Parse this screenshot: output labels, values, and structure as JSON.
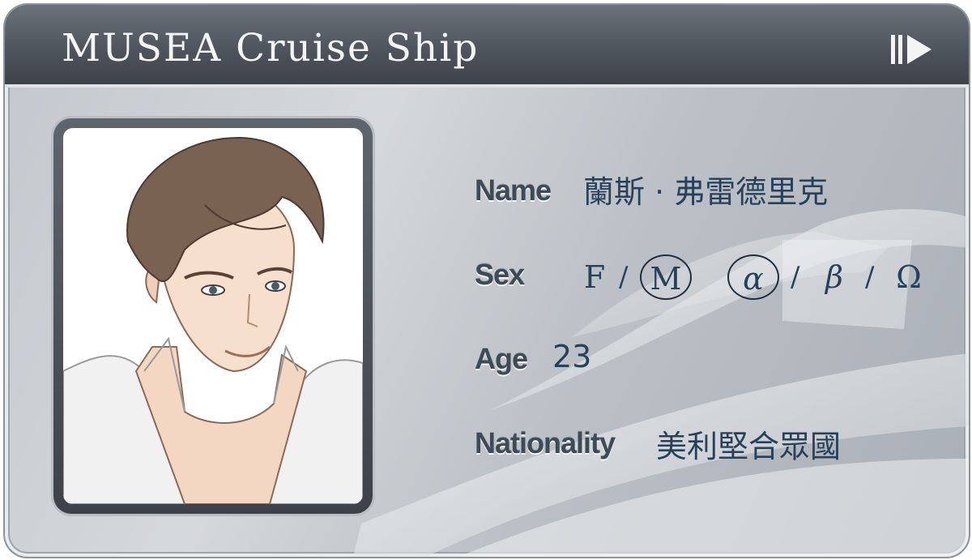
{
  "header": {
    "title": "MUSEA Cruise Ship",
    "skip_icon": "skip-forward-icon"
  },
  "profile": {
    "portrait": "character-portrait",
    "name": {
      "label": "Name",
      "value": "蘭斯 · 弗雷德里克"
    },
    "sex": {
      "label": "Sex",
      "gender_options": [
        "F",
        "M"
      ],
      "gender_selected": "M",
      "secondary_options": [
        "α",
        "β",
        "Ω"
      ],
      "secondary_selected": "α",
      "separator": "/"
    },
    "age": {
      "label": "Age",
      "value": "23"
    },
    "nationality": {
      "label": "Nationality",
      "value": "美利堅合眾國"
    }
  },
  "colors": {
    "header": "#4f555c",
    "card": "#c3c7cd",
    "label": "#3e4a55",
    "value": "#27415a"
  }
}
